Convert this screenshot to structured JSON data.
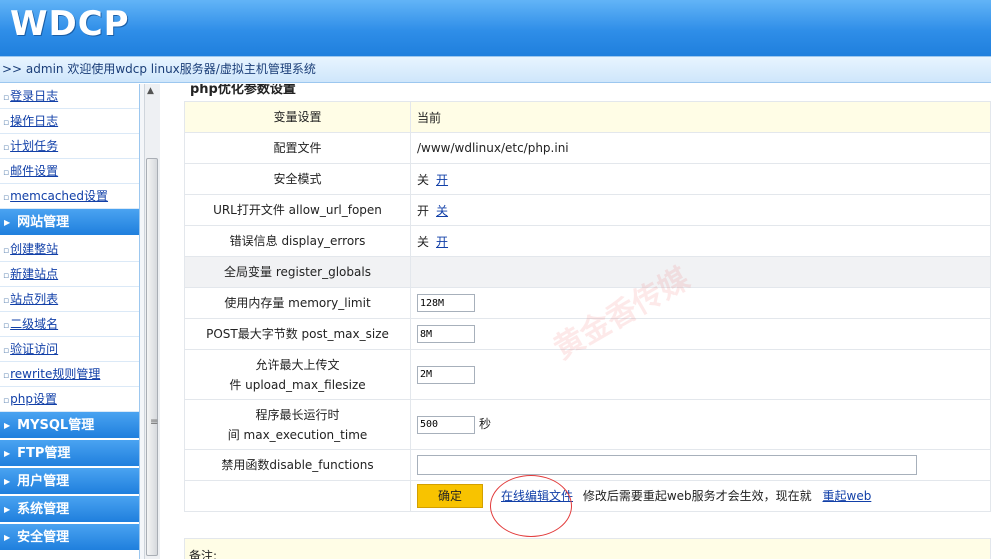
{
  "header": {
    "logo": "WDCP",
    "welcome": ">> admin 欢迎使用wdcp linux服务器/虚拟主机管理系统"
  },
  "sidebar": {
    "group1": [
      "登录日志",
      "操作日志",
      "计划任务",
      "邮件设置",
      "memcached设置"
    ],
    "site_category": "网站管理",
    "site_items": [
      "创建整站",
      "新建站点",
      "站点列表",
      "二级域名",
      "验证访问",
      "rewrite规则管理",
      "php设置"
    ],
    "categories": [
      "MYSQL管理",
      "FTP管理",
      "用户管理",
      "系统管理",
      "安全管理"
    ]
  },
  "main": {
    "section_title": "php优化参数设置",
    "header_row": {
      "label": "变量设置",
      "value": "当前"
    },
    "config_file": {
      "label": "配置文件",
      "value": "/www/wdlinux/etc/php.ini"
    },
    "safe_mode": {
      "label": "安全模式",
      "current": "关",
      "option": "开"
    },
    "allow_url_fopen": {
      "label": "URL打开文件 allow_url_fopen",
      "current": "开",
      "option": "关"
    },
    "display_errors": {
      "label": "错误信息 display_errors",
      "current": "关",
      "option": "开"
    },
    "register_globals": {
      "label": "全局变量 register_globals"
    },
    "memory_limit": {
      "label": "使用内存量 memory_limit",
      "value": "128M"
    },
    "post_max_size": {
      "label": "POST最大字节数 post_max_size",
      "value": "8M"
    },
    "upload_max_filesize": {
      "label_line1": "允许最大上传文",
      "label_line2": "件 upload_max_filesize",
      "value": "2M"
    },
    "max_execution_time": {
      "label_line1": "程序最长运行时",
      "label_line2": "间 max_execution_time",
      "value": "500",
      "unit": "秒"
    },
    "disable_functions": {
      "label": "禁用函数disable_functions",
      "value": ""
    },
    "actions": {
      "confirm": "确定",
      "edit_link": "在线编辑文件",
      "note_text": "修改后需要重起web服务才会生效，现在就",
      "restart_link": "重起web"
    },
    "notes_label": "备注:"
  },
  "watermark": "黄金香传媒",
  "colors": {
    "header_blue": "#2f8ee8",
    "link_blue": "#1240a8",
    "button_yellow": "#f8c300",
    "highlight_red": "#e23b3b"
  }
}
